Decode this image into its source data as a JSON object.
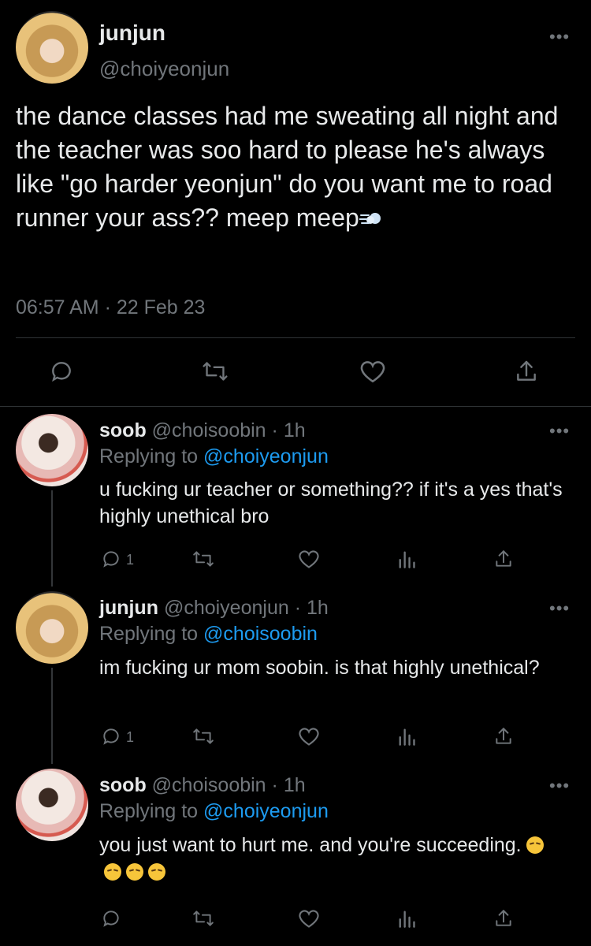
{
  "main_tweet": {
    "name": "junjun",
    "handle": "@choiyeonjun",
    "text": "the dance classes had me sweating all night and the teacher was soo hard to please he's always like \"go harder yeonjun\" do you want me to road runner your ass?? meep meep",
    "timestamp": "06:57 AM · 22 Feb 23",
    "more_label": "•••"
  },
  "replies": [
    {
      "name": "soob",
      "handle": "@choisoobin",
      "time": "· 1h",
      "replying_prefix": "Replying to",
      "replying_to": "@choiyeonjun",
      "text": "u fucking ur teacher or something?? if it's a yes that's highly unethical bro",
      "reply_count": "1"
    },
    {
      "name": "junjun",
      "handle": "@choiyeonjun",
      "time": "· 1h",
      "replying_prefix": "Replying to",
      "replying_to": "@choisoobin",
      "text": "im fucking ur mom soobin. is that highly unethical?",
      "reply_count": "1"
    },
    {
      "name": "soob",
      "handle": "@choisoobin",
      "time": "· 1h",
      "replying_prefix": "Replying to",
      "replying_to": "@choiyeonjun",
      "text": "you just want to hurt me. and you're succeeding.",
      "reply_count": ""
    }
  ],
  "icons": {
    "reply": "speech-bubble-icon",
    "retweet": "retweet-icon",
    "like": "heart-icon",
    "share": "share-icon",
    "analytics": "bar-chart-icon"
  },
  "colors": {
    "background": "#000000",
    "text": "#e7e9ea",
    "muted": "#71767b",
    "link": "#1d9bf0",
    "divider": "#2f3336"
  }
}
